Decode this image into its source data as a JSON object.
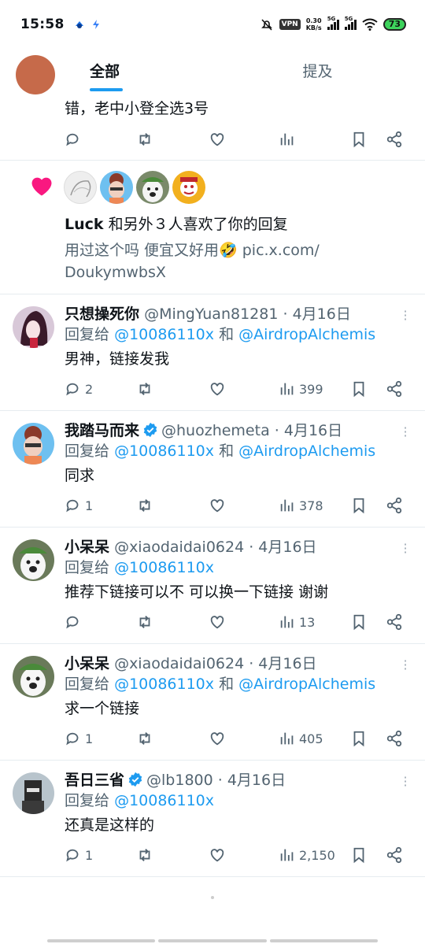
{
  "status": {
    "time": "15:58",
    "speed_top": "0.30",
    "speed_bottom": "KB/s",
    "vpn": "VPN",
    "net1": "5G",
    "net2": "5G",
    "battery": "73"
  },
  "tabs": [
    {
      "label": "全部"
    },
    {
      "label": "提及"
    }
  ],
  "top_item": {
    "text": "错，老中小登全选3号"
  },
  "like_notice": {
    "bold": "Luck",
    "rest": " 和另外３人喜欢了你的回复",
    "quote_line1": "用过这个吗 便宜又好用🤣 pic.x.com/",
    "quote_line2": "DoukymwbsX"
  },
  "replies": [
    {
      "name": "只想操死你",
      "handle": "@MingYuan81281",
      "date": "4月16日",
      "reply_prefix": "回复给",
      "reply_to1": "@10086110x",
      "reply_and": "和",
      "reply_to2": "@AirdropAlchemis",
      "text": "男神，链接发我",
      "replies": "2",
      "views": "399",
      "verified": false
    },
    {
      "name": "我踏马而来",
      "handle": "@huozhemeta",
      "date": "4月16日",
      "reply_prefix": "回复给",
      "reply_to1": "@10086110x",
      "reply_and": "和",
      "reply_to2": "@AirdropAlchemis",
      "text": "同求",
      "replies": "1",
      "views": "378",
      "verified": true
    },
    {
      "name": "小呆呆",
      "handle": "@xiaodaidai0624",
      "date": "4月16日",
      "reply_prefix": "回复给",
      "reply_to1": "@10086110x",
      "reply_and": "",
      "reply_to2": "",
      "text": "推荐下链接可以不 可以换一下链接 谢谢",
      "replies": "",
      "views": "13",
      "verified": false
    },
    {
      "name": "小呆呆",
      "handle": "@xiaodaidai0624",
      "date": "4月16日",
      "reply_prefix": "回复给",
      "reply_to1": "@10086110x",
      "reply_and": "和",
      "reply_to2": "@AirdropAlchemis",
      "text": "求一个链接",
      "replies": "1",
      "views": "405",
      "verified": false
    },
    {
      "name": "吾日三省",
      "handle": "@lb1800",
      "date": "4月16日",
      "reply_prefix": "回复给",
      "reply_to1": "@10086110x",
      "reply_and": "",
      "reply_to2": "",
      "text": "还真是这样的",
      "replies": "1",
      "views": "2,150",
      "verified": true
    }
  ],
  "colors": {
    "accent": "#1d9bf0",
    "like": "#f91880",
    "text": "#0f1419",
    "muted": "#536471"
  }
}
